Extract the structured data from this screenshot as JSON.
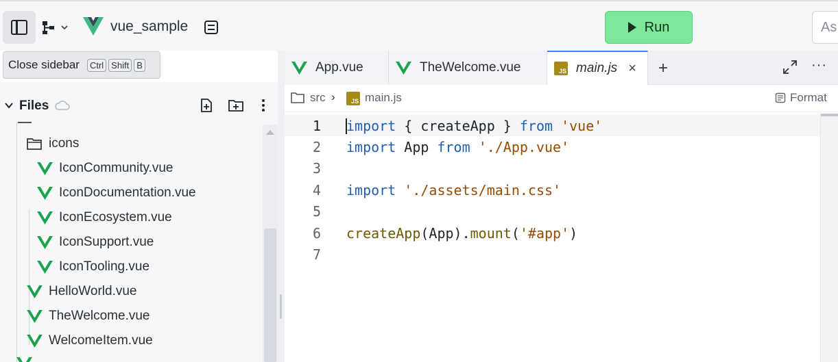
{
  "topbar": {
    "project_name": "vue_sample",
    "run_label": "Run",
    "ask_placeholder": "As"
  },
  "tooltip": {
    "label": "Close sidebar",
    "keys": [
      "Ctrl",
      "Shift",
      "B"
    ]
  },
  "files": {
    "title": "Files",
    "tree": [
      {
        "name": "icons",
        "type": "folder"
      },
      {
        "name": "IconCommunity.vue",
        "type": "vue"
      },
      {
        "name": "IconDocumentation.vue",
        "type": "vue"
      },
      {
        "name": "IconEcosystem.vue",
        "type": "vue"
      },
      {
        "name": "IconSupport.vue",
        "type": "vue"
      },
      {
        "name": "IconTooling.vue",
        "type": "vue"
      },
      {
        "name": "HelloWorld.vue",
        "type": "vue"
      },
      {
        "name": "TheWelcome.vue",
        "type": "vue"
      },
      {
        "name": "WelcomeItem.vue",
        "type": "vue"
      }
    ]
  },
  "editor": {
    "tabs": [
      {
        "label": "App.vue",
        "icon": "vue-icon"
      },
      {
        "label": "TheWelcome.vue",
        "icon": "vue-icon"
      },
      {
        "label": "main.js",
        "icon": "js-icon",
        "active": true
      }
    ],
    "breadcrumb": {
      "folder": "src",
      "file": "main.js"
    },
    "format_label": "Format",
    "lines": [
      {
        "n": "1",
        "text": "import { createApp } from 'vue'"
      },
      {
        "n": "2",
        "text": "import App from './App.vue'"
      },
      {
        "n": "3",
        "text": ""
      },
      {
        "n": "4",
        "text": "import './assets/main.css'"
      },
      {
        "n": "5",
        "text": ""
      },
      {
        "n": "6",
        "text": "createApp(App).mount('#app')"
      },
      {
        "n": "7",
        "text": ""
      }
    ]
  },
  "colors": {
    "run_bg": "#7ee89a",
    "vue_green": "#1aa34a",
    "active_tab_accent": "#3b82f6",
    "keyword": "#1e5fb8",
    "string": "#9a4a00"
  }
}
